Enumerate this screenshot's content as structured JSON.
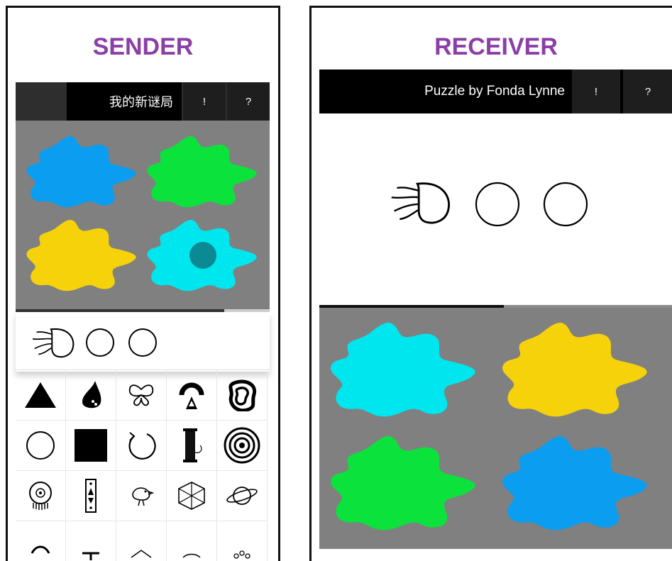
{
  "sender": {
    "title": "SENDER",
    "puzzle_name": "我的新谜局",
    "alert_label": "!",
    "help_label": "?",
    "progress": 0.82,
    "blobs": [
      {
        "color": "#0A9DF0",
        "name": "blob-blue"
      },
      {
        "color": "#0BE23B",
        "name": "blob-green"
      },
      {
        "color": "#F5D20A",
        "name": "blob-yellow"
      },
      {
        "color": "#00E6EE",
        "name": "blob-cyan"
      }
    ],
    "marker_color": "#0C8A93",
    "slots": [
      "jellyfish-icon",
      "empty-circle-icon",
      "empty-circle-icon"
    ],
    "palette": [
      "triangle-icon",
      "drop-icon",
      "butterfly-icon",
      "arch-icon",
      "swirl-icon",
      "circle-icon",
      "square-icon",
      "refresh-icon",
      "spool-icon",
      "target-icon",
      "eye-icon",
      "totem-icon",
      "bird-icon",
      "polyhedron-icon",
      "planet-icon"
    ]
  },
  "receiver": {
    "title": "RECEIVER",
    "puzzle_name": "Puzzle by Fonda Lynne",
    "alert_label": "!",
    "help_label": "?",
    "progress": 0.5,
    "slots": [
      "jellyfish-icon",
      "empty-circle-icon",
      "empty-circle-icon"
    ],
    "blobs": [
      {
        "color": "#00E6EE",
        "name": "blob-cyan"
      },
      {
        "color": "#F5D20A",
        "name": "blob-yellow"
      },
      {
        "color": "#0BE23B",
        "name": "blob-green"
      },
      {
        "color": "#0A9DF0",
        "name": "blob-blue"
      }
    ]
  }
}
